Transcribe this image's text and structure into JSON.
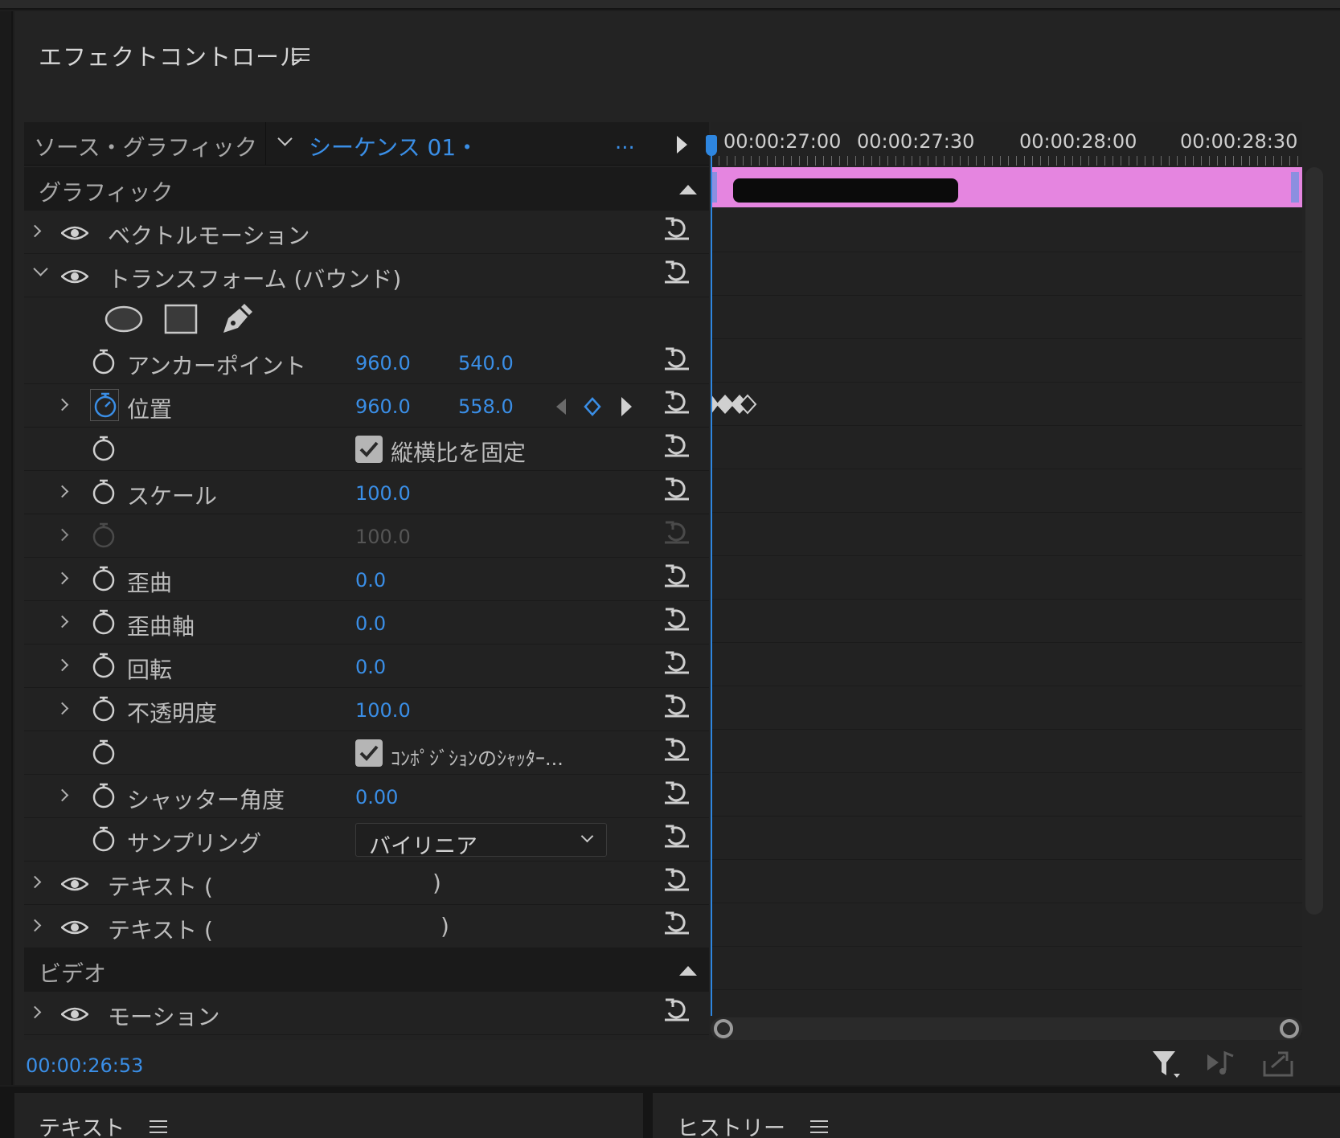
{
  "panel": {
    "title": "エフェクトコントロール"
  },
  "source_bar": {
    "source": "ソース・グラフィック",
    "sequence": "シーケンス 01・",
    "more": "..."
  },
  "sections": {
    "graphics": "グラフィック",
    "video": "ビデオ"
  },
  "effects": {
    "vector_motion": "ベクトルモーション",
    "transform": "トランスフォーム (バウンド)",
    "text1": "テキスト (",
    "text1_end": ")",
    "text2": "テキスト (",
    "text2_end": ")",
    "motion": "モーション"
  },
  "properties": {
    "anchor": {
      "label": "アンカーポイント",
      "x": "960.0",
      "y": "540.0"
    },
    "position": {
      "label": "位置",
      "x": "960.0",
      "y": "558.0"
    },
    "aspect": {
      "label": "縦横比を固定"
    },
    "scale": {
      "label": "スケール",
      "value": "100.0"
    },
    "scale_width": {
      "value": "100.0"
    },
    "skew": {
      "label": "歪曲",
      "value": "0.0"
    },
    "skew_axis": {
      "label": "歪曲軸",
      "value": "0.0"
    },
    "rotation": {
      "label": "回転",
      "value": "0.0"
    },
    "opacity": {
      "label": "不透明度",
      "value": "100.0"
    },
    "comp_shutter": {
      "label": "ｺﾝﾎﾟｼﾞｼｮﾝのｼｬｯﾀｰ..."
    },
    "shutter_angle": {
      "label": "シャッター角度",
      "value": "0.00"
    },
    "sampling": {
      "label": "サンプリング",
      "value": "バイリニア"
    }
  },
  "timeline": {
    "timecodes": [
      "00:00:27:00",
      "00:00:27:30",
      "00:00:28:00",
      "00:00:28:30"
    ],
    "current_time": "00:00:26:53"
  },
  "bottom_panels": {
    "left": "テキスト",
    "right": "ヒストリー"
  },
  "colors": {
    "accent": "#3a8ee6",
    "clip": "#e585e0",
    "background": "#232323"
  },
  "icons": [
    "eye-icon",
    "stopwatch-icon",
    "reset-icon",
    "ellipse-mask-icon",
    "rectangle-mask-icon",
    "pen-mask-icon",
    "filter-icon",
    "audio-loop-icon",
    "export-icon"
  ]
}
